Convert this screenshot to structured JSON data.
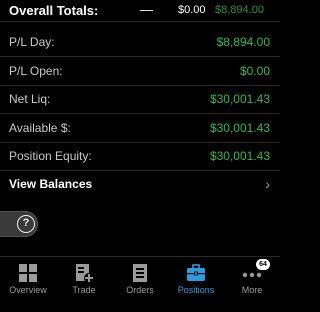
{
  "totals": {
    "title": "Overall Totals:",
    "dash": "—",
    "value_zero": "$0.00",
    "value_green": "$8,894.00"
  },
  "rows": [
    {
      "label": "P/L Day:",
      "value": "$8,894.00"
    },
    {
      "label": "P/L Open:",
      "value": "$0.00"
    },
    {
      "label": "Net Liq:",
      "value": "$30,001.43"
    },
    {
      "label": "Available $:",
      "value": "$30,001.43"
    },
    {
      "label": "Position Equity:",
      "value": "$30,001.43"
    }
  ],
  "view_balances": {
    "label": "View Balances",
    "chevron": "›"
  },
  "help": {
    "glyph": "?"
  },
  "tabs": [
    {
      "label": "Overview",
      "icon": "grid-icon"
    },
    {
      "label": "Trade",
      "icon": "trade-plus-icon"
    },
    {
      "label": "Orders",
      "icon": "orders-list-icon"
    },
    {
      "label": "Positions",
      "icon": "briefcase-icon",
      "active": true
    },
    {
      "label": "More",
      "icon": "more-dots-icon",
      "badge": "64"
    }
  ],
  "colors": {
    "background": "#000000",
    "positive_green": "#2eb84a",
    "active_tab": "#2f9bdf",
    "muted": "#9a9a9a"
  }
}
